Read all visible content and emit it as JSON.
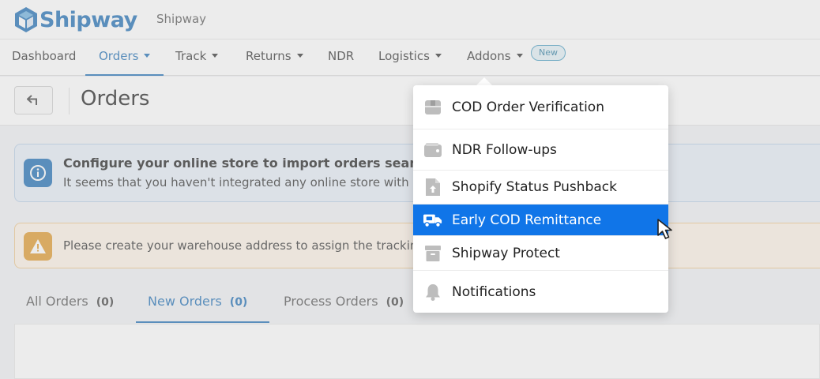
{
  "header": {
    "logo_text": "Shipway",
    "company_name": "Shipway"
  },
  "nav": {
    "items": [
      {
        "label": "Dashboard",
        "dropdown": false
      },
      {
        "label": "Orders",
        "dropdown": true,
        "active": true
      },
      {
        "label": "Track",
        "dropdown": true
      },
      {
        "label": "Returns",
        "dropdown": true
      },
      {
        "label": "NDR",
        "dropdown": false
      },
      {
        "label": "Logistics",
        "dropdown": true
      },
      {
        "label": "Addons",
        "dropdown": true
      }
    ],
    "new_badge": "New"
  },
  "page": {
    "title": "Orders",
    "back_icon": "back-arrow-icon"
  },
  "alerts": {
    "info": {
      "icon": "info-icon",
      "title": "Configure your online store to import orders seamlessly",
      "text": "It seems that you haven't integrated any online store with Shipway yet."
    },
    "warning": {
      "icon": "warning-icon",
      "text": "Please create your warehouse address to assign the tracking details to orders."
    }
  },
  "tabs": [
    {
      "label": "All Orders",
      "count": "(0)"
    },
    {
      "label": "New Orders",
      "count": "(0)",
      "active": true
    },
    {
      "label": "Process Orders",
      "count": "(0)"
    }
  ],
  "addons_menu": {
    "items": [
      {
        "label": "COD Order Verification",
        "icon": "box-check-icon"
      },
      {
        "label": "NDR Follow-ups",
        "icon": "wallet-icon"
      },
      {
        "label": "Shopify Status Pushback",
        "icon": "file-upload-icon"
      },
      {
        "label": "Early COD Remittance",
        "icon": "truck-cash-icon",
        "highlighted": true
      },
      {
        "label": "Shipway Protect",
        "icon": "archive-box-icon"
      },
      {
        "label": "Notifications",
        "icon": "bell-icon"
      }
    ]
  },
  "colors": {
    "brand": "#1f6fb5",
    "highlight": "#1075e8",
    "warning": "#e09a2d"
  }
}
